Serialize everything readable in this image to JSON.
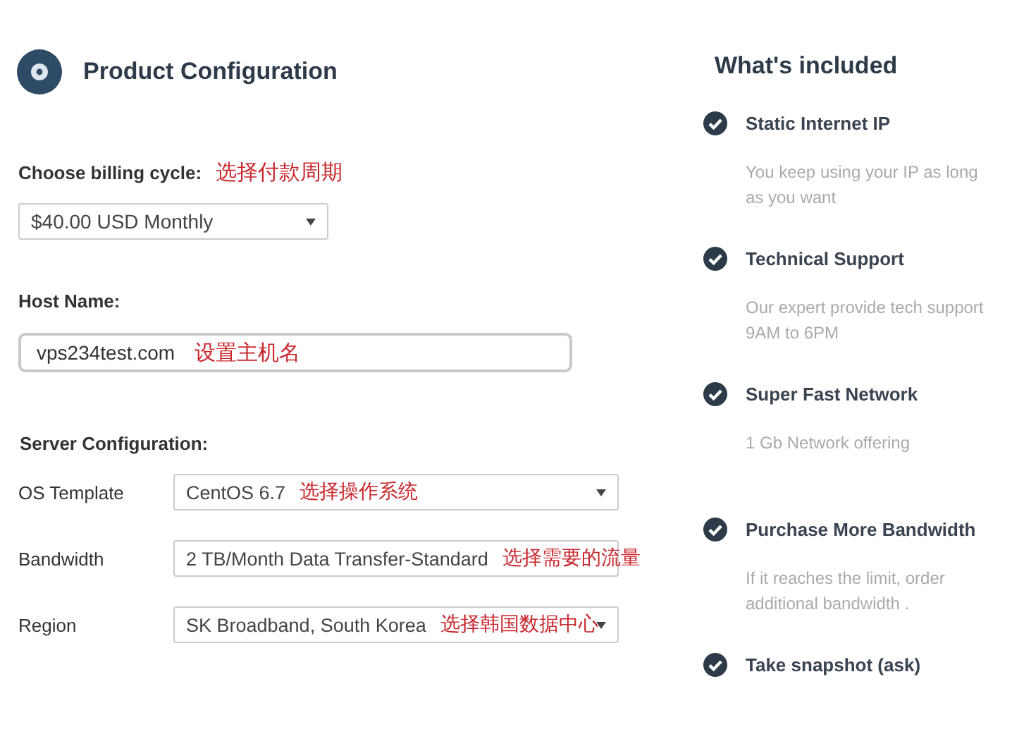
{
  "product_configuration": {
    "title": "Product Configuration",
    "billing_cycle": {
      "label": "Choose billing cycle:",
      "note": "选择付款周期",
      "value": "$40.00 USD Monthly"
    },
    "host_name": {
      "label": "Host Name:",
      "value": "vps234test.com",
      "note": "设置主机名"
    },
    "server_configuration": {
      "label": "Server Configuration:",
      "fields": [
        {
          "label": "OS Template",
          "value": "CentOS 6.7",
          "note": "选择操作系统",
          "caret_hidden": false
        },
        {
          "label": "Bandwidth",
          "value": "2 TB/Month Data Transfer-Standard",
          "note": "选择需要的流量",
          "caret_hidden": true
        },
        {
          "label": "Region",
          "value": "SK Broadband, South Korea",
          "note": "选择韩国数据中心",
          "caret_hidden": false
        }
      ]
    }
  },
  "whats_included": {
    "title": "What's included",
    "items": [
      {
        "title": "Static Internet IP",
        "description": "You keep using your IP as long as you want"
      },
      {
        "title": "Technical Support",
        "description": "Our expert provide tech support 9AM to 6PM"
      },
      {
        "title": "Super Fast Network",
        "description": "1 Gb Network offering"
      },
      {
        "title": "Purchase More Bandwidth",
        "description": "If it reaches the limit, order additional bandwidth ."
      },
      {
        "title": "Take snapshot (ask)"
      }
    ]
  }
}
